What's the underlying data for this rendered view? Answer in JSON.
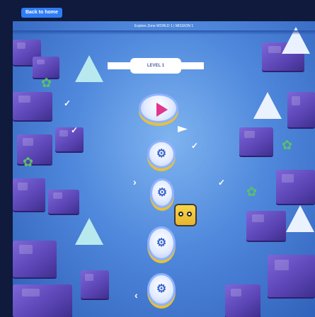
{
  "nav": {
    "back_label": "Back to home"
  },
  "header": {
    "breadcrumb": "Explore Zone WORLD 1 | MISSION 1"
  },
  "level": {
    "label": "LEVEL 1"
  },
  "path_nodes": [
    {
      "name": "start-node",
      "icon": "play-icon"
    },
    {
      "name": "node-2",
      "icon": "gear-icon"
    },
    {
      "name": "node-3",
      "icon": "gear-icon"
    },
    {
      "name": "node-4",
      "icon": "gear-icon"
    },
    {
      "name": "node-5",
      "icon": "gear-icon"
    }
  ],
  "colors": {
    "frame": "#0f1a3d",
    "back_button": "#2f7df6",
    "sky": "#4f88dc",
    "blocks": "#5a44b4",
    "accent": "#e0378c"
  }
}
